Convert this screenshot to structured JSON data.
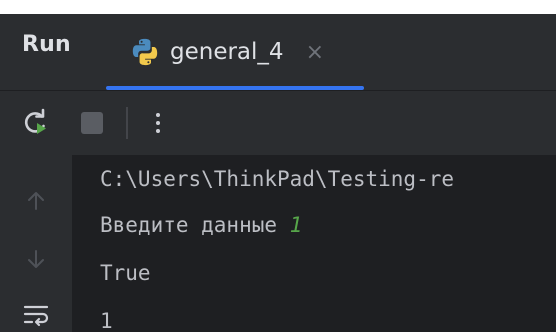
{
  "run_panel": {
    "title": "Run",
    "tab": {
      "label": "general_4",
      "close_glyph": "×",
      "icon": "python-icon"
    }
  },
  "toolbar": {
    "rerun_icon": "rerun-icon",
    "stop_icon": "stop-icon",
    "more_glyph": "more-vertical-icon"
  },
  "gutter": {
    "up_icon": "arrow-up-icon",
    "down_icon": "arrow-down-icon",
    "wrap_icon": "soft-wrap-icon"
  },
  "console": {
    "path_line": "C:\\Users\\ThinkPad\\Testing-re",
    "prompt_text": "Введите данные ",
    "prompt_input": "1",
    "result_line": "True",
    "last_line": "1"
  },
  "colors": {
    "panel_bg": "#2b2d30",
    "console_bg": "#1e1f22",
    "tab_accent": "#3574f0",
    "input_green": "#57a64a",
    "text": "#bcbec4"
  }
}
